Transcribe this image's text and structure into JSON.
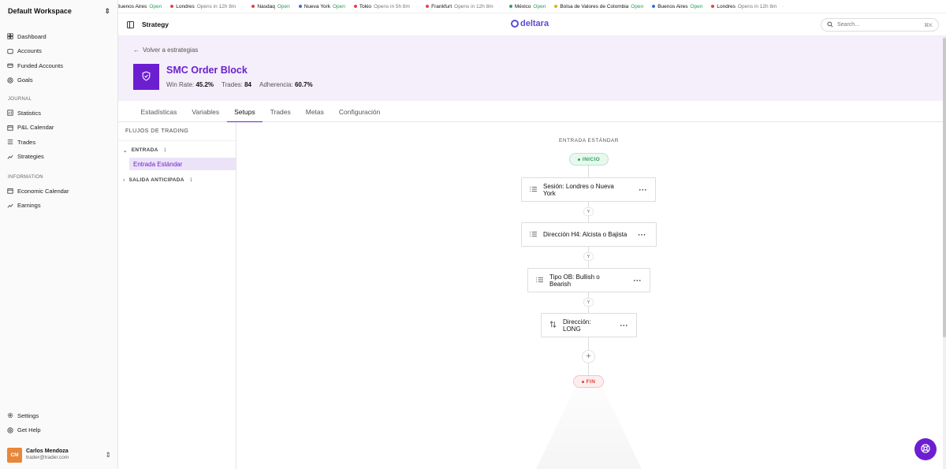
{
  "workspace": {
    "name": "Default Workspace"
  },
  "sidebar": {
    "nav": [
      {
        "label": "Dashboard",
        "icon": "dashboard-icon"
      },
      {
        "label": "Accounts",
        "icon": "wallet-icon"
      },
      {
        "label": "Funded Accounts",
        "icon": "card-icon"
      },
      {
        "label": "Goals",
        "icon": "target-icon"
      }
    ],
    "journal_label": "JOURNAL",
    "journal": [
      {
        "label": "Statistics",
        "icon": "chart-icon"
      },
      {
        "label": "P&L Calendar",
        "icon": "calendar-icon"
      },
      {
        "label": "Trades",
        "icon": "list-icon"
      },
      {
        "label": "Strategies",
        "icon": "trend-icon"
      }
    ],
    "information_label": "INFORMATION",
    "information": [
      {
        "label": "Economic Calendar",
        "icon": "calendar-icon"
      },
      {
        "label": "Earnings",
        "icon": "trend-icon"
      }
    ],
    "bottom": [
      {
        "label": "Settings",
        "icon": "gear-icon"
      },
      {
        "label": "Get Help",
        "icon": "help-icon"
      }
    ],
    "user": {
      "initials": "CM",
      "name": "Carlos Mendoza",
      "email": "trader@trader.com"
    }
  },
  "ticker": [
    {
      "market": "Buenos Aires",
      "status": "Open",
      "open": true,
      "dot": ""
    },
    {
      "market": "Londres",
      "status": "Opens in 12h 8m",
      "open": false,
      "dot": "#e04646"
    },
    {
      "market": "Nasdaq",
      "status": "Open",
      "open": true,
      "dot": "#e04646"
    },
    {
      "market": "Nueva York",
      "status": "Open",
      "open": true,
      "dot": "#3b6fd8"
    },
    {
      "market": "Tokio",
      "status": "Opens in 5h 8m",
      "open": false,
      "dot": "#e04646"
    },
    {
      "market": "Frankfurt",
      "status": "Opens in 12h 8m",
      "open": false,
      "dot": "#e04646"
    },
    {
      "market": "México",
      "status": "Open",
      "open": true,
      "dot": "#2aa35c"
    },
    {
      "market": "Bolsa de Valores de Colombia",
      "status": "Open",
      "open": true,
      "dot": "#e0b020"
    },
    {
      "market": "Buenos Aires",
      "status": "Open",
      "open": true,
      "dot": "#3b6fd8"
    },
    {
      "market": "Londres",
      "status": "Opens in 12h 8m",
      "open": false,
      "dot": "#e04646"
    }
  ],
  "topbar": {
    "title": "Strategy",
    "logo": "deltara",
    "search_placeholder": "Search...",
    "search_shortcut": "⌘K"
  },
  "strategy": {
    "back_label": "Volver a estrategias",
    "name": "SMC Order Block",
    "win_rate_label": "Win Rate:",
    "win_rate": "45.2%",
    "trades_label": "Trades:",
    "trades": "84",
    "adherence_label": "Adherencia:",
    "adherence": "60.7%"
  },
  "tabs": [
    {
      "label": "Estadísticas",
      "active": false
    },
    {
      "label": "Variables",
      "active": false
    },
    {
      "label": "Setups",
      "active": true
    },
    {
      "label": "Trades",
      "active": false
    },
    {
      "label": "Metas",
      "active": false
    },
    {
      "label": "Configuración",
      "active": false
    }
  ],
  "flows": {
    "title": "FLUJOS DE TRADING",
    "groups": [
      {
        "label": "ENTRADA",
        "count": "1",
        "expanded": true,
        "items": [
          "Entrada Estándar"
        ]
      },
      {
        "label": "SALIDA ANTICIPADA",
        "count": "1",
        "expanded": false,
        "items": []
      }
    ]
  },
  "canvas": {
    "flow_title": "ENTRADA ESTÁNDAR",
    "start_label": "INICIO",
    "end_label": "FIN",
    "connector_label": "Y",
    "nodes": [
      {
        "label": "Sesión: Londres o Nueva York",
        "icon": "list-icon"
      },
      {
        "label": "Dirección H4: Alcista o Bajista",
        "icon": "list-icon"
      },
      {
        "label": "Tipo OB: Bullish o Bearish",
        "icon": "list-icon"
      },
      {
        "label": "Dirección: LONG",
        "icon": "swap-vertical-icon"
      }
    ],
    "menu_glyph": "···",
    "add_glyph": "+"
  },
  "colors": {
    "accent": "#6c1fd1",
    "open": "#22a05a",
    "start": "#2aa35c",
    "end": "#d9453f"
  }
}
